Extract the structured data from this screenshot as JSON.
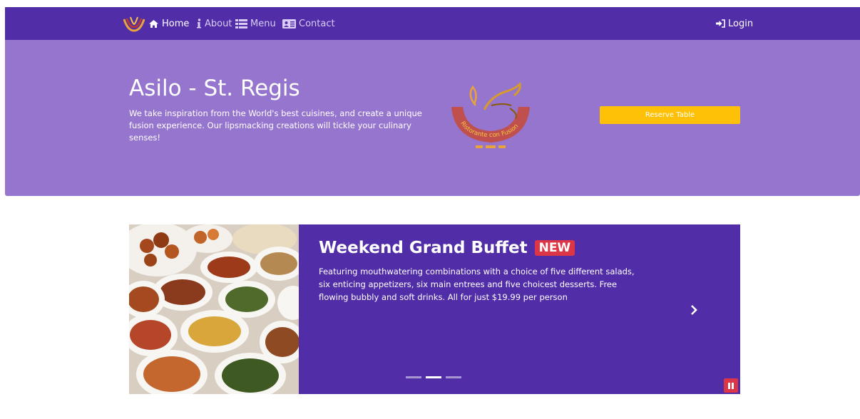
{
  "navbar": {
    "logo_icon": "restaurant-logo-icon",
    "items": [
      {
        "label": "Home",
        "icon": "home-icon",
        "active": true
      },
      {
        "label": "About",
        "icon": "info-icon",
        "active": false
      },
      {
        "label": "Menu",
        "icon": "list-icon",
        "active": false
      },
      {
        "label": "Contact",
        "icon": "address-card-icon",
        "active": false
      }
    ],
    "login": {
      "label": "Login",
      "icon": "sign-in-icon"
    }
  },
  "jumbotron": {
    "title": "Asilo - St. Regis",
    "text": "We take inspiration from the World's best cuisines, and create a unique fusion experience. Our lipsmacking creations will tickle your culinary senses!",
    "logo_lettering": "Ristorante con Fusion",
    "reserve_label": "Reserve Table"
  },
  "carousel": {
    "title": "Weekend Grand Buffet",
    "badge": "NEW",
    "text": "Featuring mouthwatering combinations with a choice of five different salads, six enticing appetizers, six main entrees and five choicest desserts. Free flowing bubbly and soft drinks. All for just $19.99 per person",
    "indicators": 3,
    "active_indicator": 1
  },
  "colors": {
    "navbar": "#512da8",
    "jumbotron": "#9575cd",
    "reserve_button": "#ffc107",
    "badge": "#dc3545",
    "carousel_bg": "#512da8"
  }
}
